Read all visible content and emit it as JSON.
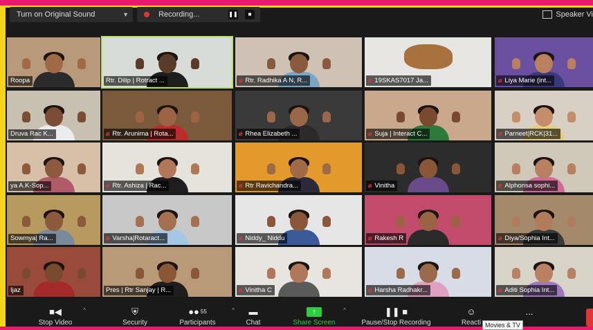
{
  "topbar": {
    "sound_label": "Turn on Original Sound",
    "recording_label": "Recording...",
    "speaker_view_label": "Speaker Vi"
  },
  "participants": [
    {
      "name": "Roopa",
      "muted": false,
      "skin": "#a06a48",
      "bg": "#b89a7a",
      "shirt": "#2b2b2b"
    },
    {
      "name": "Rtr. Dilip | Rotract ...",
      "muted": false,
      "active": true,
      "skin": "#5a3a28",
      "bg": "#d8dcd8",
      "shirt": "#1e1e1e"
    },
    {
      "name": "Rtr. Radhika A N, R...",
      "muted": true,
      "skin": "#8a5a3c",
      "bg": "#cfc2b4",
      "shirt": "#7aa6c4"
    },
    {
      "name": "19SKAS7017 Ja...",
      "muted": true,
      "object": true,
      "bg": "#e8e6e2"
    },
    {
      "name": "Liya Marie  (int...",
      "muted": true,
      "skin": "#b98060",
      "bg": "#6a4fa0",
      "shirt": "#3a3a7a"
    },
    {
      "name": "Druva Rac K...",
      "muted": false,
      "skin": "#7a4e34",
      "bg": "#c8c0b0",
      "shirt": "#ececec"
    },
    {
      "name": "Rtr. Arunima | Rota...",
      "muted": true,
      "skin": "#9c6444",
      "bg": "#7a5a3a",
      "shirt": "#c02a2a"
    },
    {
      "name": "Rhea Elizabeth ...",
      "muted": true,
      "skin": "#9a6848",
      "bg": "#3a3a3a",
      "shirt": "#2a2a2a"
    },
    {
      "name": "Suja | Interact C...",
      "muted": true,
      "skin": "#7a4a30",
      "bg": "#c9a88c",
      "shirt": "#2e7a3a"
    },
    {
      "name": "Parneet|RCK|31...",
      "muted": true,
      "skin": "#c48e6c",
      "bg": "#d8d0c4",
      "shirt": "#e4d07a"
    },
    {
      "name": "ya A.K-Sop...",
      "muted": false,
      "skin": "#8e5a3e",
      "bg": "#d6c0a8",
      "shirt": "#b05a6a"
    },
    {
      "name": "Rtr. Ashiza | Rac...",
      "muted": true,
      "skin": "#b07858",
      "bg": "#e6e2dc",
      "shirt": "#1e1e1e"
    },
    {
      "name": "Rtr Ravichandra...",
      "muted": true,
      "skin": "#a06a48",
      "bg": "#e49a2a",
      "shirt": "#2a2a3a"
    },
    {
      "name": "Vinitha",
      "muted": true,
      "skin": "#8a5638",
      "bg": "#2c2c2c",
      "shirt": "#6a4a8a"
    },
    {
      "name": "Alphonsa sophi...",
      "muted": true,
      "skin": "#b88060",
      "bg": "#d0c8b8",
      "shirt": "#d06a9a"
    },
    {
      "name": "Sowmya| Ra...",
      "muted": false,
      "skin": "#8a5a3a",
      "bg": "#b89a60",
      "shirt": "#7a8a9a"
    },
    {
      "name": "Varsha|Rotaract...",
      "muted": true,
      "skin": "#a47050",
      "bg": "#c8c8c8",
      "shirt": "#a4c8e4"
    },
    {
      "name": "Niddy_ Niddu",
      "muted": true,
      "skin": "#8a5838",
      "bg": "#e6e6e6",
      "shirt": "#3a5a9a"
    },
    {
      "name": "Rakesh R",
      "muted": true,
      "skin": "#9a6444",
      "bg": "#c24a6a",
      "shirt": "#2a2a2a"
    },
    {
      "name": "Diya/Sophia Int...",
      "muted": true,
      "skin": "#b07c5c",
      "bg": "#a48a6a",
      "shirt": "#3a3a3a"
    },
    {
      "name": "Ijaz",
      "muted": false,
      "skin": "#7a4a2e",
      "bg": "#9a4a3a",
      "shirt": "#a42a2a"
    },
    {
      "name": "Pres | Rtr Sanjay | R...",
      "muted": false,
      "skin": "#8a5638",
      "bg": "#b89a78",
      "shirt": "#1e1e1e"
    },
    {
      "name": "Vinitha C",
      "muted": true,
      "skin": "#b07858",
      "bg": "#e8e4e0",
      "shirt": "#5a5a5a"
    },
    {
      "name": "Harsha Radhakr...",
      "muted": true,
      "skin": "#9a6a4a",
      "bg": "#d8dce6",
      "shirt": "#e0a0c0"
    },
    {
      "name": "Aditi Sophia Int...",
      "muted": true,
      "skin": "#b88262",
      "bg": "#d8d4ca",
      "shirt": "#a07ac0"
    }
  ],
  "toolbar": {
    "stop_video": "Stop Video",
    "security": "Security",
    "participants": "Participants",
    "participant_count": "55",
    "chat": "Chat",
    "share_screen": "Share Screen",
    "pause_recording": "Pause/Stop Recording",
    "reactions": "Reacti",
    "more": "..."
  },
  "tooltip": "Movies & TV",
  "colors": {
    "accent_pink": "#e8196a",
    "accent_yellow": "#f2d51c",
    "active_speaker": "#b6e35a",
    "share_green": "#2ecc40",
    "mute_red": "#e23434"
  }
}
